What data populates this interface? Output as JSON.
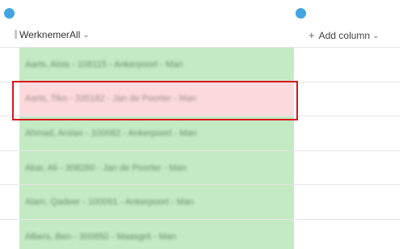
{
  "header": {
    "column_title": "WerknemerAll",
    "add_column_label": "Add column"
  },
  "rows": [
    {
      "text": "Aarts, Alois - 108115 - Ankerpoort - Man",
      "status": "green"
    },
    {
      "text": "Aarts, Tiko - 335182 - Jan de Poorter - Man",
      "status": "red"
    },
    {
      "text": "Ahmad, Arslan - 100082 - Ankerpoort - Man",
      "status": "green"
    },
    {
      "text": "Akar, Ali - 308280 - Jan de Poorter - Man",
      "status": "green"
    },
    {
      "text": "Alam, Qadeer - 100091 - Ankerpoort - Man",
      "status": "green"
    },
    {
      "text": "Albers, Ben - 300850 - Maasgrit - Man",
      "status": "green"
    }
  ],
  "colors": {
    "accent_dot": "#41a5e1",
    "row_green": "#c3eac3",
    "row_red": "#fadadd",
    "highlight_border": "#d8161e"
  }
}
